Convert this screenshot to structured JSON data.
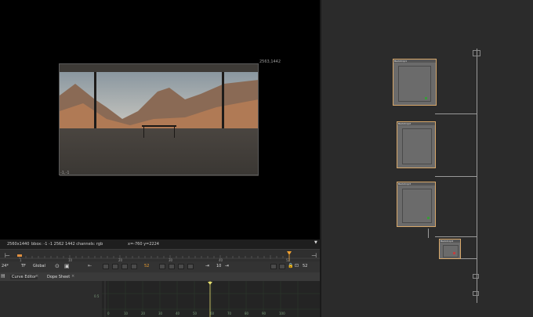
{
  "viewer": {
    "top_right_label": "2563,1442",
    "bottom_left_label": "-1,-1",
    "info": {
      "format": "2560x1440",
      "bbox": "bbox: -1 -1 2562 1442 channels: rgb",
      "coords": "x=-760 y=2224"
    }
  },
  "timeline": {
    "ticks": [
      "1",
      "10",
      "20",
      "30",
      "40",
      "52"
    ],
    "current_frame": "52",
    "end_frame": "52",
    "fps": "24*",
    "tf": "TF",
    "mode": "Global",
    "step": "10"
  },
  "tabs": [
    {
      "label": "Curve Editor"
    },
    {
      "label": "Dope Sheet"
    }
  ],
  "curve_editor": {
    "y_label": "0.5",
    "x_ticks": [
      "0",
      "10",
      "20",
      "30",
      "40",
      "50",
      "60",
      "70",
      "80",
      "90",
      "100"
    ]
  },
  "node_graph": {
    "nodes": [
      {
        "label": "Backdrop1"
      },
      {
        "label": "Backdrop2"
      },
      {
        "label": "Backdrop3"
      },
      {
        "label": "Backdrop4"
      }
    ]
  },
  "colors": {
    "viewer_bg": "#000000",
    "panel_bg": "#262626",
    "node_border": "#d8a86a",
    "playhead": "#f0a030"
  }
}
